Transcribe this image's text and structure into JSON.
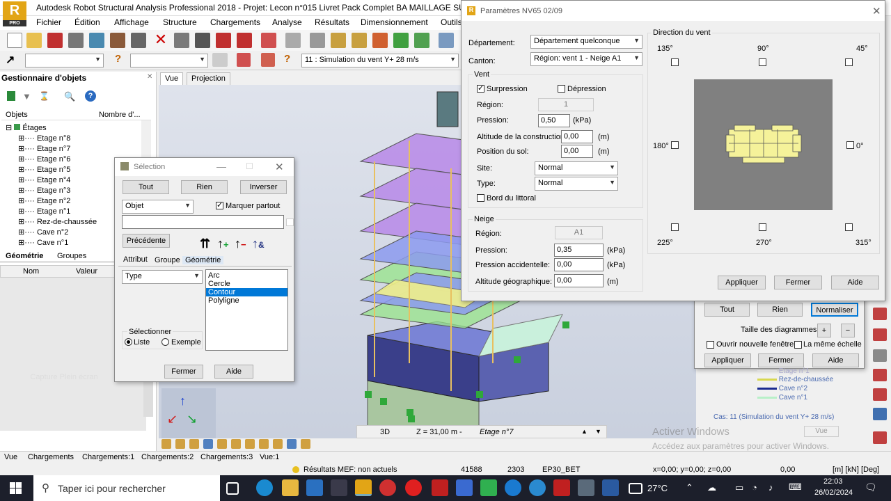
{
  "window": {
    "title": "Autodesk Robot Structural Analysis Professional 2018 - Projet: Lecon n°015 Livret Pack Complet BA MAILLAGE SUR UN R+7-",
    "app_badge": "R",
    "app_sub": "PRO"
  },
  "menu": [
    "Fichier",
    "Édition",
    "Affichage",
    "Structure",
    "Chargements",
    "Analyse",
    "Résultats",
    "Dimensionnement",
    "Outils"
  ],
  "toolbar2": {
    "load_case": "11 : Simulation du vent Y+ 28 m/s"
  },
  "object_manager": {
    "title": "Gestionnaire d'objets",
    "col_objects": "Objets",
    "col_count": "Nombre d'...",
    "root": "Étages",
    "items": [
      "Etage n°8",
      "Etage n°7",
      "Etage n°6",
      "Etage n°5",
      "Etage n°4",
      "Etage n°3",
      "Etage n°2",
      "Etage n°1",
      "Rez-de-chaussée",
      "Cave n°2",
      "Cave n°1"
    ],
    "tab_geometry": "Géométrie",
    "tab_groups": "Groupes",
    "col_name": "Nom",
    "col_value": "Valeur",
    "capture": "Capture Plein écran"
  },
  "view_tabs": {
    "vue": "Vue",
    "projection": "Projection"
  },
  "selection_dialog": {
    "title": "Sélection",
    "btn_all": "Tout",
    "btn_none": "Rien",
    "btn_invert": "Inverser",
    "object_combo": "Objet",
    "mark_everywhere": "Marquer partout",
    "previous": "Précédente",
    "tab_attribute": "Attribut",
    "tab_group": "Groupe",
    "tab_geometry": "Géométrie",
    "type_combo": "Type",
    "types": [
      "Arc",
      "Cercle",
      "Contour",
      "Polyligne"
    ],
    "selected_type": "Contour",
    "select_group": "Sélectionner",
    "radio_list": "Liste",
    "radio_example": "Exemple",
    "close": "Fermer",
    "help": "Aide"
  },
  "params_dialog": {
    "title": "Paramètres  NV65 02/09",
    "departement_label": "Département:",
    "departement": "Département quelconque",
    "canton_label": "Canton:",
    "canton": "Région: vent 1 - Neige A1",
    "vent": {
      "group": "Vent",
      "surpression": "Surpression",
      "depression": "Dépression",
      "region_label": "Région:",
      "region": "1",
      "pression_label": "Pression:",
      "pression": "0,50",
      "kpa": "(kPa)",
      "altitude_label": "Altitude de la construction:",
      "altitude": "0,00",
      "m": "(m)",
      "position_label": "Position du sol:",
      "position": "0,00",
      "site_label": "Site:",
      "site": "Normal",
      "type_label": "Type:",
      "type": "Normal",
      "bord": "Bord du littoral"
    },
    "neige": {
      "group": "Neige",
      "region_label": "Région:",
      "region": "A1",
      "pression_label": "Pression:",
      "pression": "0,35",
      "kpa": "(kPa)",
      "acc_label": "Pression accidentelle:",
      "acc": "0,00",
      "alt_label": "Altitude géographique:",
      "alt": "0,00",
      "m": "(m)"
    },
    "direction": {
      "group": "Direction du vent",
      "a135": "135°",
      "a90": "90°",
      "a45": "45°",
      "a180": "180°",
      "a0": "0°",
      "a225": "225°",
      "a270": "270°",
      "a315": "315°"
    },
    "apply": "Appliquer",
    "close": "Fermer",
    "help": "Aide"
  },
  "diagram_panel": {
    "all": "Tout",
    "none": "Rien",
    "normalize": "Normaliser",
    "size_label": "Taille des diagrammes:",
    "plus": "+",
    "minus": "−",
    "new_window": "Ouvrir nouvelle fenêtre",
    "same_scale": "La même échelle",
    "apply": "Appliquer",
    "close": "Fermer",
    "help": "Aide"
  },
  "legend": {
    "items": [
      "Etage n°1",
      "Rez-de-chaussée",
      "Cave n°2",
      "Cave n°1"
    ],
    "case": "Cas: 11 (Simulation du vent Y+ 28 m/s)"
  },
  "viewport_bar": {
    "mode": "3D",
    "z": "Z = 31,00 m - ",
    "level": "Etage n°7",
    "view": "Vue"
  },
  "watermark": {
    "line1": "Activer Windows",
    "line2": "Accédez aux paramètres pour activer Windows."
  },
  "status_tabs": [
    "Vue",
    "Chargements",
    "Chargements:1",
    "Chargements:2",
    "Chargements:3",
    "Vue:1"
  ],
  "status": {
    "results": "Résultats MEF: non actuels",
    "n1": "41588",
    "n2": "2303",
    "section": "EP30_BET",
    "coords": "x=0,00; y=0,00; z=0,00",
    "val": "0,00",
    "units": "[m] [kN] [Deg]"
  },
  "taskbar": {
    "search": "Taper ici pour rechercher",
    "temp": "27°C",
    "time": "22:03",
    "date": "26/02/2024"
  }
}
